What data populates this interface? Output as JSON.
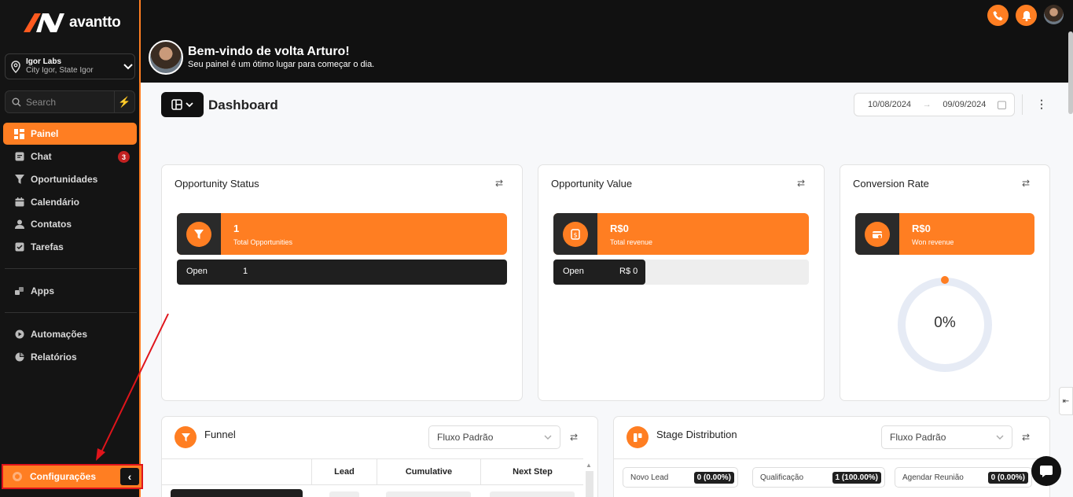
{
  "brand": {
    "name": "avantto",
    "accent": "#ff7e22"
  },
  "location": {
    "name": "Igor Labs",
    "address": "City Igor, State Igor"
  },
  "search": {
    "placeholder": "Search"
  },
  "nav": {
    "items": [
      {
        "label": "Painel",
        "icon": "dashboard-icon"
      },
      {
        "label": "Chat",
        "icon": "chat-icon",
        "badge": "3"
      },
      {
        "label": "Oportunidades",
        "icon": "funnel-icon"
      },
      {
        "label": "Calendário",
        "icon": "calendar-icon"
      },
      {
        "label": "Contatos",
        "icon": "user-icon"
      },
      {
        "label": "Tarefas",
        "icon": "check-icon"
      },
      {
        "label": "Apps",
        "icon": "apps-icon"
      },
      {
        "label": "Automações",
        "icon": "automation-icon"
      },
      {
        "label": "Relatórios",
        "icon": "reports-icon"
      }
    ],
    "settings": "Configurações"
  },
  "header": {
    "welcome_title": "Bem-vindo de volta Arturo!",
    "welcome_sub": "Seu painel é um ótimo lugar para começar o dia."
  },
  "dashboard": {
    "title": "Dashboard",
    "date_from": "10/08/2024",
    "date_to": "09/09/2024"
  },
  "cards": {
    "opportunity_status": {
      "title": "Opportunity Status",
      "kpi_value": "1",
      "kpi_label": "Total Opportunities",
      "row_label": "Open",
      "row_value": "1",
      "row_fill": 1.0
    },
    "opportunity_value": {
      "title": "Opportunity Value",
      "kpi_value": "R$0",
      "kpi_label": "Total revenue",
      "row_label": "Open",
      "row_value": "R$ 0",
      "row_fill": 0.36
    },
    "conversion_rate": {
      "title": "Conversion Rate",
      "kpi_value": "R$0",
      "kpi_label": "Won revenue",
      "gauge_value": "0%"
    },
    "funnel": {
      "title": "Funnel",
      "pipeline": "Fluxo Padrão",
      "columns": [
        "",
        "Lead",
        "Cumulative",
        "Next Step"
      ]
    },
    "stage_distribution": {
      "title": "Stage Distribution",
      "pipeline": "Fluxo Padrão",
      "stages": [
        {
          "name": "Novo Lead",
          "count": "0 (0.00%)"
        },
        {
          "name": "Qualificação",
          "count": "1 (100.00%)"
        },
        {
          "name": "Agendar Reunião",
          "count": "0 (0.00%)"
        }
      ]
    }
  }
}
